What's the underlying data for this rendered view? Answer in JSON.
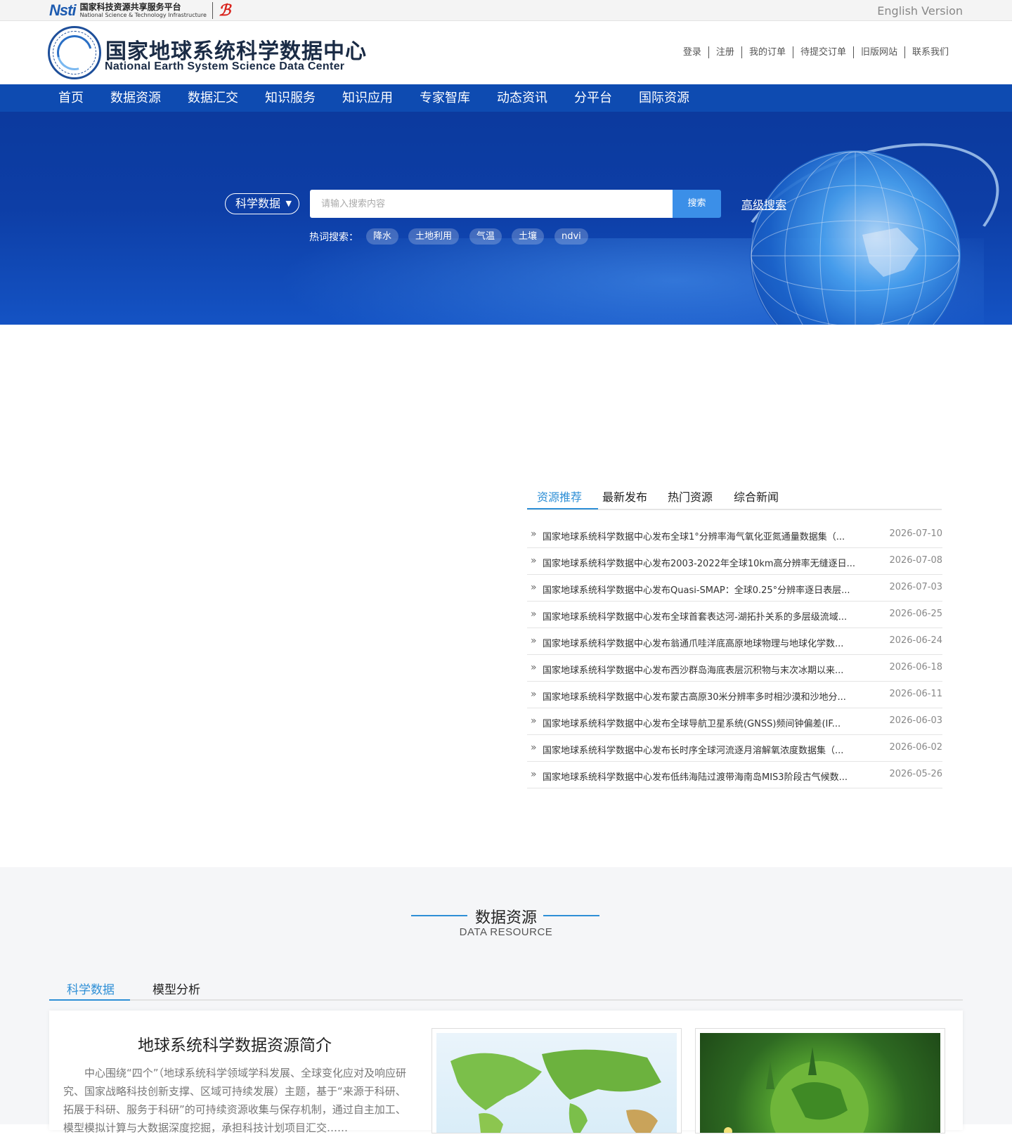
{
  "platform": {
    "brand": "Nsti",
    "name_cn": "国家科技资源共享服务平台",
    "name_en": "National Science & Technology Infrastructure",
    "english_version": "English Version"
  },
  "site": {
    "title": "国家地球系统科学数据中心",
    "subtitle": "National Earth System Science Data Center"
  },
  "user_links": [
    "登录",
    "注册",
    "我的订单",
    "待提交订单",
    "旧版网站",
    "联系我们"
  ],
  "nav": [
    "首页",
    "数据资源",
    "数据汇交",
    "知识服务",
    "知识应用",
    "专家智库",
    "动态资讯",
    "分平台",
    "国际资源"
  ],
  "search": {
    "category": "科学数据",
    "placeholder": "请输入搜索内容",
    "button": "搜索",
    "advanced": "高级搜索",
    "hot_label": "热词搜索：",
    "hot_words": [
      "降水",
      "土地利用",
      "气温",
      "土壤",
      "ndvi"
    ]
  },
  "news": {
    "tabs": [
      "资源推荐",
      "最新发布",
      "热门资源",
      "综合新闻"
    ],
    "active_tab": "资源推荐",
    "items": [
      {
        "title": "国家地球系统科学数据中心发布全球1°分辨率海气氧化亚氮通量数据集（...",
        "date": "2026-07-10"
      },
      {
        "title": "国家地球系统科学数据中心发布2003-2022年全球10km高分辨率无缝逐日...",
        "date": "2026-07-08"
      },
      {
        "title": "国家地球系统科学数据中心发布Quasi-SMAP：全球0.25°分辨率逐日表层...",
        "date": "2026-07-03"
      },
      {
        "title": "国家地球系统科学数据中心发布全球首套表达河-湖拓扑关系的多层级流域...",
        "date": "2026-06-25"
      },
      {
        "title": "国家地球系统科学数据中心发布翁通爪哇洋底高原地球物理与地球化学数...",
        "date": "2026-06-24"
      },
      {
        "title": "国家地球系统科学数据中心发布西沙群岛海底表层沉积物与末次冰期以来...",
        "date": "2026-06-18"
      },
      {
        "title": "国家地球系统科学数据中心发布蒙古高原30米分辨率多时相沙漠和沙地分...",
        "date": "2026-06-11"
      },
      {
        "title": "国家地球系统科学数据中心发布全球导航卫星系统(GNSS)频间钟偏差(IF...",
        "date": "2026-06-03"
      },
      {
        "title": "国家地球系统科学数据中心发布长时序全球河流逐月溶解氧浓度数据集（...",
        "date": "2026-06-02"
      },
      {
        "title": "国家地球系统科学数据中心发布低纬海陆过渡带海南岛MIS3阶段古气候数...",
        "date": "2026-05-26"
      }
    ]
  },
  "resource": {
    "title": "数据资源",
    "subtitle": "DATA RESOURCE",
    "tabs": [
      "科学数据",
      "模型分析"
    ],
    "active_tab": "科学数据",
    "intro_title": "地球系统科学数据资源简介",
    "intro_text": "中心围绕“四个”（地球系统科学领域学科发展、全球变化应对及响应研究、国家战略科技创新支撑、区域可持续发展）主题，基于“来源于科研、拓展于科研、服务于科研”的可持续资源收集与保存机制，通过自主加工、模型模拟计算与大数据深度挖掘，承担科技计划项目汇交……"
  },
  "colors": {
    "nav_bg": "#0e4bb1",
    "accent": "#2e8fd6",
    "search_button": "#3b8fe8"
  }
}
